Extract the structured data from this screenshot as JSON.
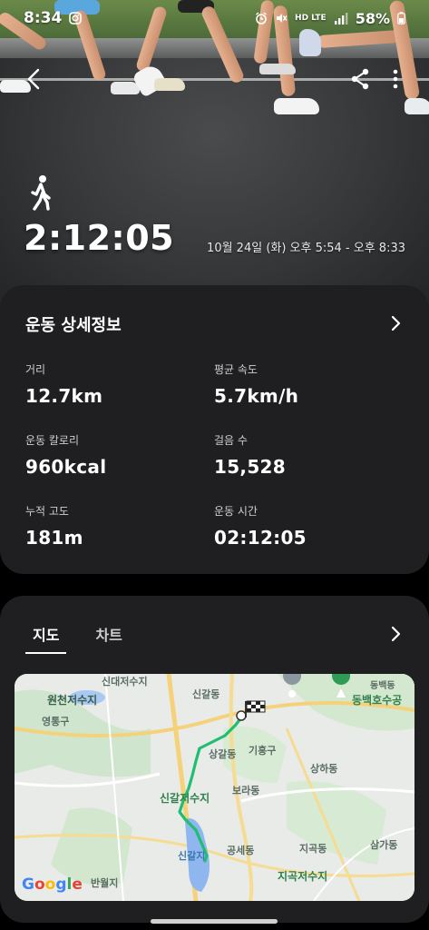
{
  "status_bar": {
    "time": "8:34",
    "network": "HD LTE",
    "battery": "58%"
  },
  "workout": {
    "duration": "2:12:05",
    "date_range": "10월 24일 (화) 오후 5:54 - 오후 8:33"
  },
  "details": {
    "title": "운동 상세정보",
    "stats": [
      {
        "label": "거리",
        "value": "12.7km"
      },
      {
        "label": "평균 속도",
        "value": "5.7km/h"
      },
      {
        "label": "운동 칼로리",
        "value": "960kcal"
      },
      {
        "label": "걸음 수",
        "value": "15,528"
      },
      {
        "label": "누적 고도",
        "value": "181m"
      },
      {
        "label": "운동 시간",
        "value": "02:12:05"
      }
    ]
  },
  "map_card": {
    "tabs": [
      {
        "label": "지도",
        "active": true
      },
      {
        "label": "차트",
        "active": false
      }
    ],
    "map_labels": [
      "신대저수지",
      "원천저수지",
      "영통구",
      "신갈동",
      "상갈동",
      "기흥구",
      "상하동",
      "보라동",
      "신갈저수지",
      "공세동",
      "신갈지",
      "지곡동",
      "지곡저수지",
      "삼가동",
      "동백동",
      "동백호수공",
      "반월지"
    ],
    "attribution": "Google"
  },
  "colors": {
    "card_bg": "#1f1f21",
    "route": "#1fbf73",
    "water": "#8fb6ee"
  }
}
